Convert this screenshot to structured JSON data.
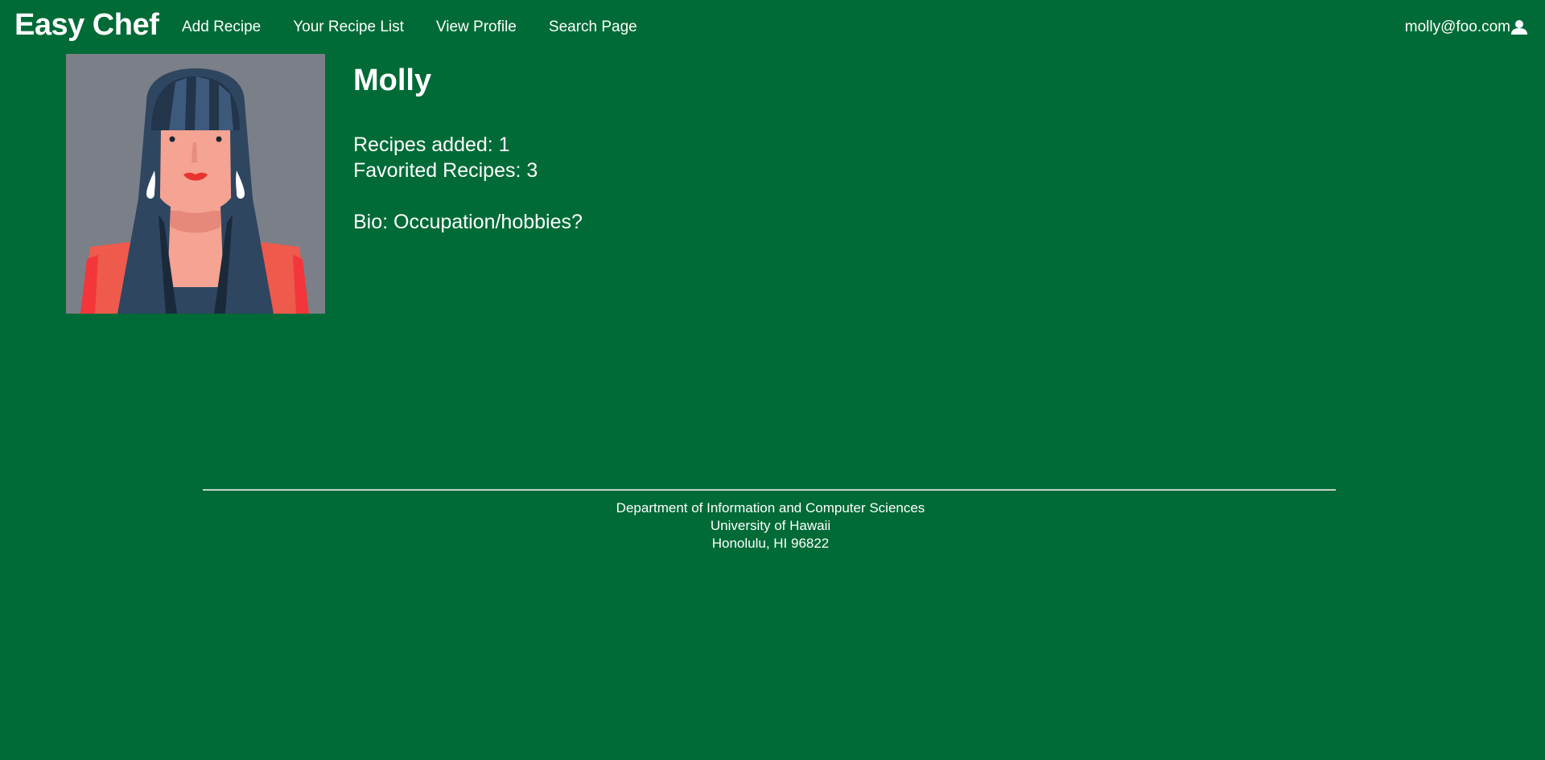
{
  "navbar": {
    "brand": "Easy Chef",
    "links": [
      "Add Recipe",
      "Your Recipe List",
      "View Profile",
      "Search Page"
    ],
    "user_email": "molly@foo.com",
    "user_icon": "user-icon"
  },
  "profile": {
    "name": "Molly",
    "recipes_added": "Recipes added: 1",
    "favorited_recipes": "Favorited Recipes: 3",
    "bio": "Bio: Occupation/hobbies?",
    "avatar_icon": "woman-avatar"
  },
  "footer": {
    "line1": "Department of Information and Computer Sciences",
    "line2": "University of Hawaii",
    "line3": "Honolulu, HI 96822"
  },
  "colors": {
    "background": "#006b36",
    "text": "#ffffff"
  }
}
